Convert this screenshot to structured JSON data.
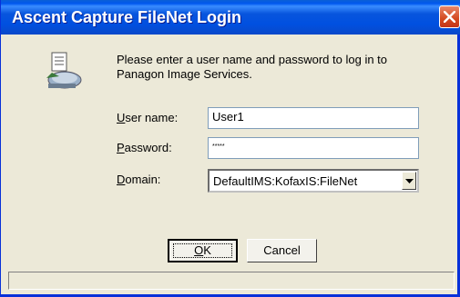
{
  "window": {
    "title": "Ascent Capture FileNet Login",
    "message": "Please enter a user name and password to log in to Panagon Image Services."
  },
  "form": {
    "username": {
      "label_underlined": "U",
      "label_rest": "ser name:",
      "value": "User1"
    },
    "password": {
      "label_underlined": "P",
      "label_rest": "assword:",
      "value": "*****"
    },
    "domain": {
      "label_underlined": "D",
      "label_rest": "omain:",
      "value": "DefaultIMS:KofaxIS:FileNet"
    }
  },
  "buttons": {
    "ok_underlined": "O",
    "ok_rest": "K",
    "cancel": "Cancel"
  },
  "icons": {
    "close": "close-icon",
    "app": "scanner-icon",
    "dropdown": "chevron-down-icon"
  },
  "colors": {
    "titlebar": "#0058ee",
    "close_button": "#d4491f",
    "dialog_bg": "#ece9d8"
  }
}
